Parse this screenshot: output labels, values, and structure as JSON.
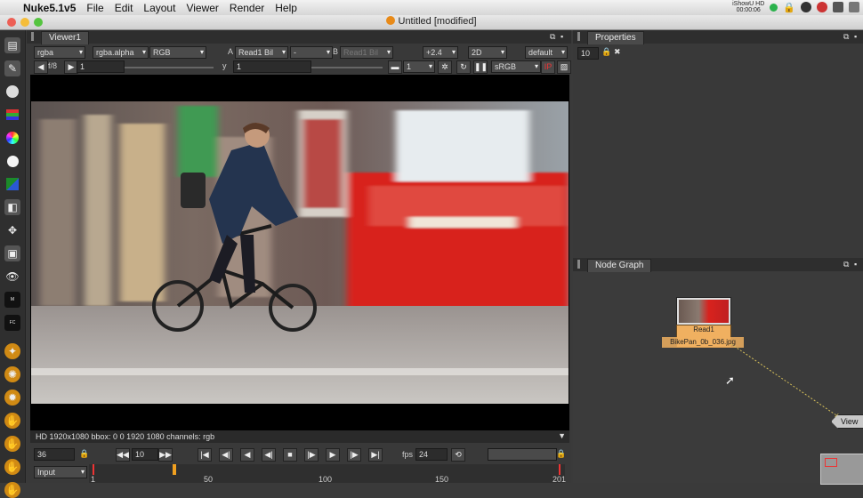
{
  "menubar": {
    "app_name": "Nuke5.1v5",
    "items": [
      "File",
      "Edit",
      "Layout",
      "Viewer",
      "Render",
      "Help"
    ],
    "recorder_label": "iShowU HD",
    "recorder_time": "00:00:06"
  },
  "window": {
    "title": "Untitled [modified]"
  },
  "viewer": {
    "tab_label": "Viewer1",
    "channels": "rgba",
    "alpha": "rgba.alpha",
    "display": "RGB",
    "input_a_label": "A",
    "input_a": "Read1 Bil",
    "wipe_mode": "-",
    "input_b_label": "B",
    "input_b": "Read1 Bil",
    "gain": "+2.4",
    "view_mode": "2D",
    "lut_default": "default",
    "fstop": "f/8",
    "gain_value": "1",
    "y_label": "y",
    "gamma_value": "1",
    "proxy_value": "1",
    "colorspace": "sRGB",
    "info_bar": "HD 1920x1080 bbox: 0 0 1920 1080 channels: rgb"
  },
  "timeline": {
    "current_frame": "36",
    "step": "10",
    "fps_label": "fps",
    "fps": "24",
    "input_mode": "Input",
    "ticks": [
      "1",
      "50",
      "100",
      "150",
      "201"
    ]
  },
  "properties": {
    "tab_label": "Properties",
    "max_panels": "10"
  },
  "node_graph": {
    "tab_label": "Node Graph",
    "read_node_name": "Read1",
    "read_node_file": "BikePan_0b_036.jpg",
    "viewer_node_label": "View"
  },
  "colors": {
    "read_node": "#f0b060",
    "bus_red": "#d8221e",
    "panel_bg": "#393939",
    "dark_bg": "#2f2f2f"
  }
}
